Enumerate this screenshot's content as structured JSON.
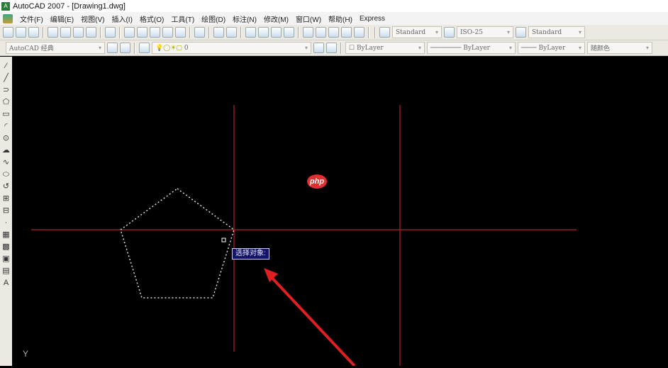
{
  "window": {
    "title": "AutoCAD 2007 - [Drawing1.dwg]"
  },
  "menu": [
    "文件(F)",
    "编辑(E)",
    "视图(V)",
    "插入(I)",
    "格式(O)",
    "工具(T)",
    "绘图(D)",
    "标注(N)",
    "修改(M)",
    "窗口(W)",
    "帮助(H)",
    "Express"
  ],
  "styles": {
    "text_style": "Standard",
    "dim_style": "ISO-25",
    "table_style": "Standard"
  },
  "toolbar2": {
    "workspace": "AutoCAD 经典",
    "layer": "0",
    "color": "ByLayer",
    "linetype": "ByLayer",
    "lineweight": "ByLayer",
    "plotstyle": "随颜色"
  },
  "left_tools": [
    "line",
    "construction-line",
    "polyline",
    "polygon",
    "rectangle",
    "arc",
    "circle",
    "revision-cloud",
    "spline",
    "ellipse",
    "ellipse-arc",
    "insert-block",
    "make-block",
    "point",
    "hatch",
    "gradient",
    "region",
    "table",
    "multiline-text"
  ],
  "left_glyphs": [
    "⁄",
    "╱",
    "⊃",
    "⬠",
    "▭",
    "◜",
    "⊙",
    "☁",
    "∿",
    "⬭",
    "↺",
    "⊞",
    "⊟",
    "·",
    "▦",
    "▩",
    "▣",
    "▤",
    "A"
  ],
  "canvas": {
    "tooltip": "选择对象:",
    "axis_label": "Y",
    "watermark": "php"
  },
  "colors": {
    "crosshair": "#b0202a",
    "arrow": "#e02020",
    "tooltip_bg": "#141468"
  }
}
